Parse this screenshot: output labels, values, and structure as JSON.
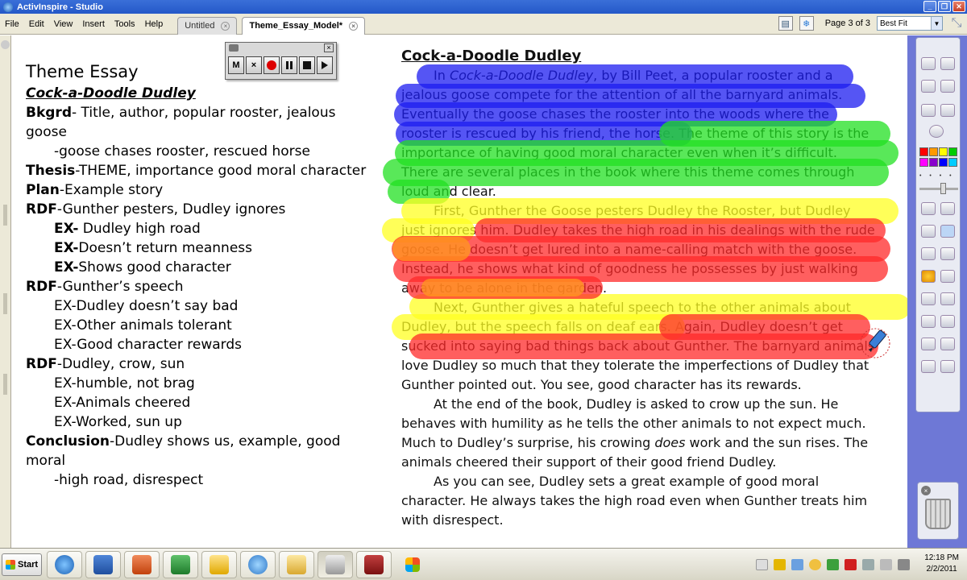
{
  "window": {
    "title": "ActivInspire - Studio"
  },
  "menu": [
    "File",
    "Edit",
    "View",
    "Insert",
    "Tools",
    "Help"
  ],
  "tabs": [
    {
      "label": "Untitled",
      "active": false
    },
    {
      "label": "Theme_Essay_Model*",
      "active": true
    }
  ],
  "page_indicator": "Page 3 of 3",
  "zoom": {
    "selected": "Best Fit"
  },
  "recorder": {
    "buttons": [
      "M",
      "×"
    ]
  },
  "notes": {
    "title": "Theme Essay",
    "subtitle": "Cock-a-Doodle Dudley",
    "lines": [
      {
        "label": "Bkgrd",
        "text": "- Title, author, popular rooster, jealous goose",
        "indent": 0
      },
      {
        "label": "",
        "text": "-goose chases rooster, rescued horse",
        "indent": 1
      },
      {
        "label": "Thesis",
        "text": "-THEME, importance good moral character",
        "indent": 0
      },
      {
        "label": "Plan",
        "text": "-Example story",
        "indent": 0
      },
      {
        "label": "RDF",
        "text": "-Gunther pesters, Dudley ignores",
        "indent": 0
      },
      {
        "label": "EX-",
        "text": " Dudley high road",
        "indent": 1
      },
      {
        "label": "EX-",
        "text": "Doesn’t return meanness",
        "indent": 1
      },
      {
        "label": "EX-",
        "text": "Shows good character",
        "indent": 1
      },
      {
        "label": "RDF",
        "text": "-Gunther’s speech",
        "indent": 0
      },
      {
        "label": "",
        "text": "EX-Dudley doesn’t say bad",
        "indent": 1
      },
      {
        "label": "",
        "text": "EX-Other animals tolerant",
        "indent": 1
      },
      {
        "label": "",
        "text": "EX-Good character rewards",
        "indent": 1
      },
      {
        "label": "RDF",
        "text": "-Dudley, crow, sun",
        "indent": 0
      },
      {
        "label": "",
        "text": "EX-humble, not brag",
        "indent": 1
      },
      {
        "label": "",
        "text": "EX-Animals cheered",
        "indent": 1
      },
      {
        "label": "",
        "text": "EX-Worked, sun up",
        "indent": 1
      },
      {
        "label": "Conclusion",
        "text": "-Dudley shows us, example, good moral",
        "indent": 0
      },
      {
        "label": "",
        "text": "-high road, disrespect",
        "indent": 1
      }
    ]
  },
  "essay": {
    "title": "Cock-a-Doodle Dudley",
    "p1": {
      "a": "In ",
      "italic": "Cock-a-Doodle Dudley",
      "b": ", by Bill Peet, a popular rooster and a jealous goose compete for the attention of all the barnyard animals. Eventually the goose chases the rooster into the woods where the rooster is rescued by his friend, the horse. The theme of this story is the importance of having good moral character even when it’s difficult. There are several places in the book where this theme comes through loud and clear."
    },
    "p2": "First, Gunther the Goose pesters Dudley the Rooster, but Dudley just ignores him. Dudley takes the high road in his dealings with the rude goose. He doesn’t get lured into a name-calling match with the goose. Instead, he shows what kind of goodness he possesses by just walking away to be alone in the garden.",
    "p3": "Next, Gunther gives a hateful speech to the other animals about Dudley, but the speech falls on deaf ears. Again, Dudley doesn’t get sucked into saying bad things back about Gunther. The barnyard animals love Dudley so much that they tolerate the imperfections of Dudley that Gunther pointed out. You see, good character has its rewards.",
    "p4": {
      "a": "At the end of the book, Dudley is asked to crow up the sun. He behaves with humility as he tells the other animals to not expect much. Much to Dudley’s surprise, his crowing ",
      "italic": "does",
      "b": " work and the sun rises. The animals cheered their support of their good friend Dudley."
    },
    "p5": "As you can see, Dudley sets a great example of good moral character. He always takes the high road even when Gunther treats him with disrespect."
  },
  "highlight_colors": {
    "blue": "#1c1cf0",
    "green": "#22e022",
    "yellow": "#ffff22",
    "red": "#ff2a2a",
    "orange": "#ff9a1e"
  },
  "palette": [
    "#ff0000",
    "#ff9900",
    "#ffff00",
    "#00cc00",
    "#ff00ff",
    "#8800cc",
    "#0000ff",
    "#00ccff"
  ],
  "taskbar": {
    "start_label": "Start",
    "time": "12:18 PM",
    "date": "2/2/2011"
  }
}
